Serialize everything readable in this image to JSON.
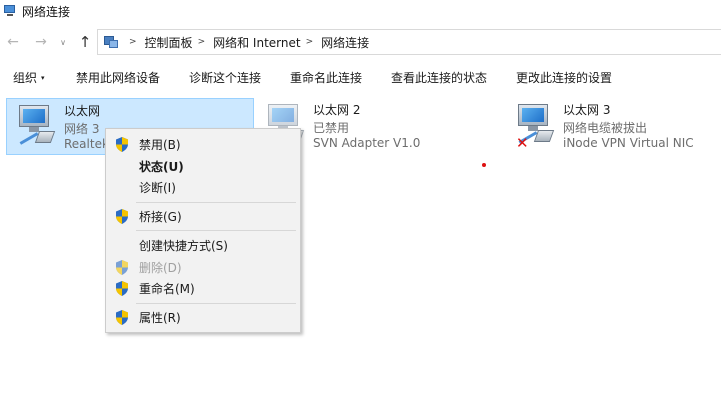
{
  "window": {
    "title": "网络连接"
  },
  "address": {
    "crumbs": [
      "控制面板",
      "网络和 Internet",
      "网络连接"
    ]
  },
  "nav": {
    "back": "←",
    "forward": "→",
    "recent": "∨",
    "up": "↑"
  },
  "toolbar": {
    "organize": "组织",
    "organize_caret": "▾",
    "disable": "禁用此网络设备",
    "diagnose": "诊断这个连接",
    "rename": "重命名此连接",
    "view_status": "查看此连接的状态",
    "change_settings": "更改此连接的设置"
  },
  "connections": [
    {
      "name": "以太网",
      "status": "网络 3",
      "device": "Realtek"
    },
    {
      "name": "以太网 2",
      "status": "已禁用",
      "device": "SVN Adapter V1.0"
    },
    {
      "name": "以太网 3",
      "status": "网络电缆被拔出",
      "device": "iNode VPN Virtual NIC",
      "error_mark": "✕"
    }
  ],
  "context_menu": {
    "disable": "禁用(B)",
    "status": "状态(U)",
    "diagnose": "诊断(I)",
    "bridge": "桥接(G)",
    "shortcut": "创建快捷方式(S)",
    "delete": "删除(D)",
    "rename": "重命名(M)",
    "properties": "属性(R)"
  },
  "colors": {
    "selection_bg": "#cce8ff",
    "selection_border": "#99d1ff",
    "menu_bg": "#f2f2f2",
    "shield_blue": "#2b6cc4",
    "shield_yellow": "#f5c400",
    "error_red": "#dd1111"
  },
  "icons": {
    "app": "network-connections-icon",
    "address": "control-panel-icon",
    "connection": "network-adapter-icon",
    "menu_shield": "uac-shield-icon"
  }
}
